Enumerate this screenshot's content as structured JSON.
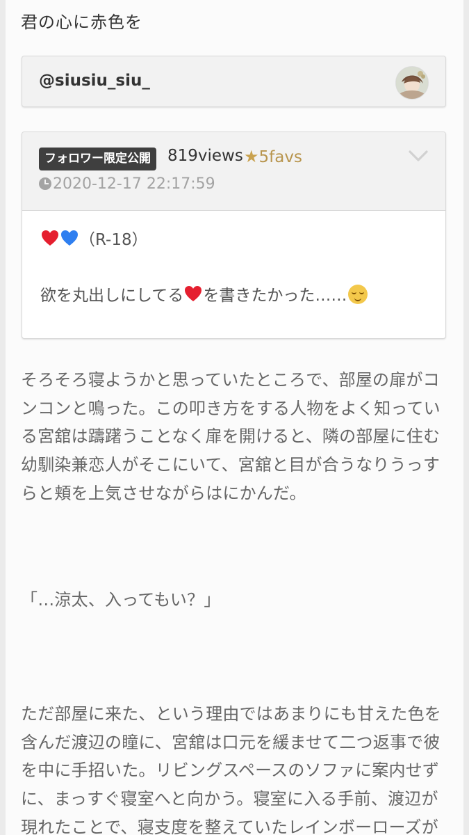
{
  "page": {
    "title": "君の心に赤色を"
  },
  "author": {
    "username": "@siusiu_siu_"
  },
  "post": {
    "badge": "フォロワー限定公開",
    "views": "819views",
    "favs": "5favs",
    "datetime": "2020-12-17 22:17:59",
    "tag_line": "（R-18）",
    "summary_prefix": "欲を丸出しにしてる",
    "summary_suffix": "を書きたかった……",
    "icons": {
      "favs": "star-icon",
      "date": "clock-icon",
      "expand": "chevron-down-icon",
      "hearts": [
        "red-heart-icon",
        "blue-heart-icon"
      ],
      "emoji": "relieved-face-icon"
    }
  },
  "story": {
    "lines": [
      "そろそろ寝ようかと思っていたところで、部屋の扉がコ",
      "ンコンと鳴った。この叩き方をする人物をよく知ってい",
      "る宮舘は躊躇うことなく扉を開けると、隣の部屋に住む",
      "幼馴染兼恋人がそこにいて、宮舘と目が合うなりうっす",
      "らと頬を上気させながらはにかんだ。"
    ],
    "quote": "「…涼太、入ってもい？」",
    "lines2": [
      "ただ部屋に来た、という理由ではあまりにも甘えた色を",
      "含んだ渡辺の瞳に、宮舘は口元を緩ませて二つ返事で彼",
      "を中に手招いた。リビングスペースのソファに案内せず",
      "に、まっすぐ寝室へと向かう。寝室に入る手前、渡辺が",
      "現れたことで、寝支度を整えていたレインボーローズが"
    ]
  },
  "colors": {
    "accent": "#b8954e",
    "badge": "#3f3f3f",
    "muted": "#a3a3a3"
  }
}
